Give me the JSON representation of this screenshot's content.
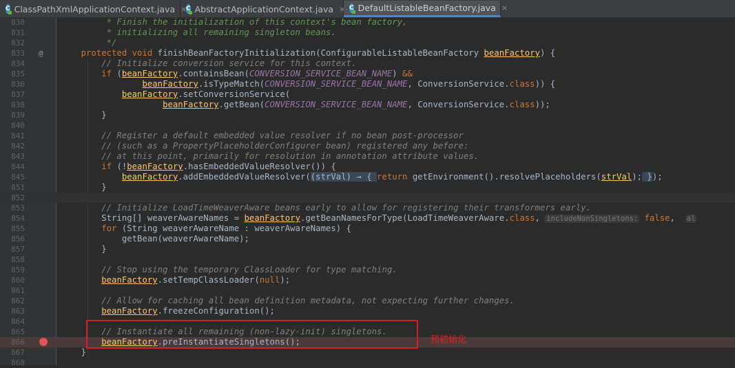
{
  "tabs": [
    {
      "label": "ClassPathXmlApplicationContext.java",
      "icon": "java-class-icon",
      "active": false
    },
    {
      "label": "AbstractApplicationContext.java",
      "icon": "java-class-icon",
      "active": false
    },
    {
      "label": "DefaultListableBeanFactory.java",
      "icon": "java-class-icon",
      "active": true
    }
  ],
  "tab_close_glyph": "×",
  "class_icon_letter": "C",
  "gutter_override_glyph": "@",
  "annotation_label": "预初始化",
  "lines": [
    {
      "n": "830",
      "t": [
        [
          "cm",
          "         * Finish the initialization of this context's bean factory,"
        ]
      ]
    },
    {
      "n": "831",
      "t": [
        [
          "cm",
          "         * initializing all remaining singleton beans."
        ]
      ]
    },
    {
      "n": "832",
      "t": [
        [
          "cm",
          "         */"
        ]
      ]
    },
    {
      "n": "833",
      "t": [
        [
          "k",
          "    protected void "
        ],
        [
          "p",
          "finishBeanFactoryInitialization(ConfigurableListableBeanFactory "
        ],
        [
          "v",
          "beanFactory"
        ],
        [
          "p",
          ") {"
        ]
      ]
    },
    {
      "n": "834",
      "t": [
        [
          "lc",
          "        // Initialize conversion service for this context."
        ]
      ]
    },
    {
      "n": "835",
      "t": [
        [
          "k",
          "        if "
        ],
        [
          "p",
          "("
        ],
        [
          "v",
          "beanFactory"
        ],
        [
          "p",
          ".containsBean("
        ],
        [
          "c",
          "CONVERSION_SERVICE_BEAN_NAME"
        ],
        [
          "p",
          ") "
        ],
        [
          "k",
          "&&"
        ]
      ]
    },
    {
      "n": "836",
      "t": [
        [
          "p",
          "                "
        ],
        [
          "v",
          "beanFactory"
        ],
        [
          "p",
          ".isTypeMatch("
        ],
        [
          "c",
          "CONVERSION_SERVICE_BEAN_NAME"
        ],
        [
          "p",
          ", ConversionService."
        ],
        [
          "k",
          "class"
        ],
        [
          "p",
          ")) {"
        ]
      ]
    },
    {
      "n": "837",
      "t": [
        [
          "p",
          "            "
        ],
        [
          "v",
          "beanFactory"
        ],
        [
          "p",
          ".setConversionService("
        ]
      ]
    },
    {
      "n": "838",
      "t": [
        [
          "p",
          "                    "
        ],
        [
          "v",
          "beanFactory"
        ],
        [
          "p",
          ".getBean("
        ],
        [
          "c",
          "CONVERSION_SERVICE_BEAN_NAME"
        ],
        [
          "p",
          ", ConversionService."
        ],
        [
          "k",
          "class"
        ],
        [
          "p",
          "));"
        ]
      ]
    },
    {
      "n": "839",
      "t": [
        [
          "p",
          "        }"
        ]
      ]
    },
    {
      "n": "840",
      "t": []
    },
    {
      "n": "841",
      "t": [
        [
          "lc",
          "        // Register a default embedded value resolver if no bean post-processor"
        ]
      ]
    },
    {
      "n": "842",
      "t": [
        [
          "lc",
          "        // (such as a PropertyPlaceholderConfigurer bean) registered any before:"
        ]
      ]
    },
    {
      "n": "843",
      "t": [
        [
          "lc",
          "        // at this point, primarily for resolution in annotation attribute values."
        ]
      ]
    },
    {
      "n": "844",
      "t": [
        [
          "k",
          "        if "
        ],
        [
          "p",
          "(!"
        ],
        [
          "v",
          "beanFactory"
        ],
        [
          "p",
          ".hasEmbeddedValueResolver()) {"
        ]
      ]
    },
    {
      "n": "845",
      "t": [
        [
          "p",
          "            "
        ],
        [
          "v",
          "beanFactory"
        ],
        [
          "p",
          ".addEmbeddedValueResolver("
        ],
        [
          "f",
          "(strVal) → { "
        ],
        [
          "k",
          "return "
        ],
        [
          "p",
          "getEnvironment().resolvePlaceholders("
        ],
        [
          "v",
          "strVal"
        ],
        [
          "p",
          ");"
        ],
        [
          "f",
          " }"
        ],
        [
          "p",
          ");"
        ]
      ]
    },
    {
      "n": "851",
      "t": [
        [
          "p",
          "        }"
        ]
      ]
    },
    {
      "n": "852",
      "t": [],
      "caret": true
    },
    {
      "n": "853",
      "t": [
        [
          "lc",
          "        // Initialize LoadTimeWeaverAware beans early to allow for registering their transformers early."
        ]
      ]
    },
    {
      "n": "854",
      "t": [
        [
          "p",
          "        String[] weaverAwareNames = "
        ],
        [
          "v",
          "beanFactory"
        ],
        [
          "p",
          ".getBeanNamesForType(LoadTimeWeaverAware."
        ],
        [
          "k",
          "class"
        ],
        [
          "p",
          ", "
        ],
        [
          "h",
          "includeNonSingletons:"
        ],
        [
          "k",
          " false"
        ],
        [
          "p",
          ",  "
        ],
        [
          "h",
          "al"
        ]
      ]
    },
    {
      "n": "855",
      "t": [
        [
          "k",
          "        for "
        ],
        [
          "p",
          "(String weaverAwareName : weaverAwareNames) {"
        ]
      ]
    },
    {
      "n": "856",
      "t": [
        [
          "p",
          "            getBean(weaverAwareName);"
        ]
      ]
    },
    {
      "n": "857",
      "t": [
        [
          "p",
          "        }"
        ]
      ]
    },
    {
      "n": "858",
      "t": []
    },
    {
      "n": "859",
      "t": [
        [
          "lc",
          "        // Stop using the temporary ClassLoader for type matching."
        ]
      ]
    },
    {
      "n": "860",
      "t": [
        [
          "p",
          "        "
        ],
        [
          "v",
          "beanFactory"
        ],
        [
          "p",
          ".setTempClassLoader("
        ],
        [
          "k",
          "null"
        ],
        [
          "p",
          ");"
        ]
      ]
    },
    {
      "n": "861",
      "t": []
    },
    {
      "n": "862",
      "t": [
        [
          "lc",
          "        // Allow for caching all bean definition metadata, not expecting further changes."
        ]
      ]
    },
    {
      "n": "863",
      "t": [
        [
          "p",
          "        "
        ],
        [
          "v",
          "beanFactory"
        ],
        [
          "p",
          ".freezeConfiguration();"
        ]
      ]
    },
    {
      "n": "864",
      "t": []
    },
    {
      "n": "865",
      "t": [
        [
          "lc",
          "        // Instantiate all remaining (non-lazy-init) singletons."
        ]
      ]
    },
    {
      "n": "866",
      "t": [
        [
          "p",
          "        "
        ],
        [
          "v",
          "beanFactory"
        ],
        [
          "p",
          ".preInstantiateSingletons();"
        ]
      ],
      "bp": true
    },
    {
      "n": "867",
      "t": [
        [
          "p",
          "    }"
        ]
      ]
    },
    {
      "n": "868",
      "t": []
    }
  ]
}
